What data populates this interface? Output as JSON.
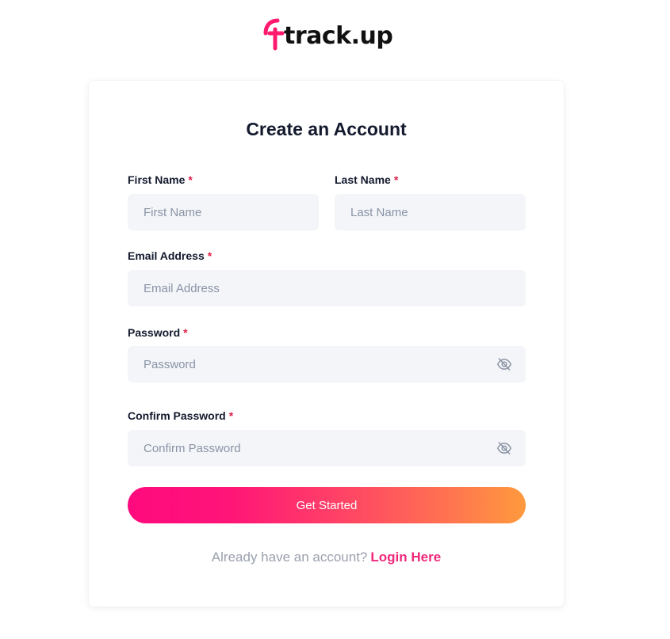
{
  "brand": {
    "logo_text": "track.up",
    "accent_color": "#ff0a7e",
    "gradient_end_color": "#ff9a3d"
  },
  "form": {
    "title": "Create an Account",
    "required_marker": "*",
    "fields": {
      "first_name": {
        "label": "First Name",
        "placeholder": "First Name"
      },
      "last_name": {
        "label": "Last Name",
        "placeholder": "Last Name"
      },
      "email": {
        "label": "Email Address",
        "placeholder": "Email Address"
      },
      "password": {
        "label": "Password",
        "placeholder": "Password",
        "toggle_icon": "eye-off-icon"
      },
      "confirm_password": {
        "label": "Confirm Password",
        "placeholder": "Confirm Password",
        "toggle_icon": "eye-off-icon"
      }
    },
    "submit_label": "Get Started"
  },
  "footer": {
    "prompt": "Already have an account?",
    "link_label": "Login Here"
  }
}
